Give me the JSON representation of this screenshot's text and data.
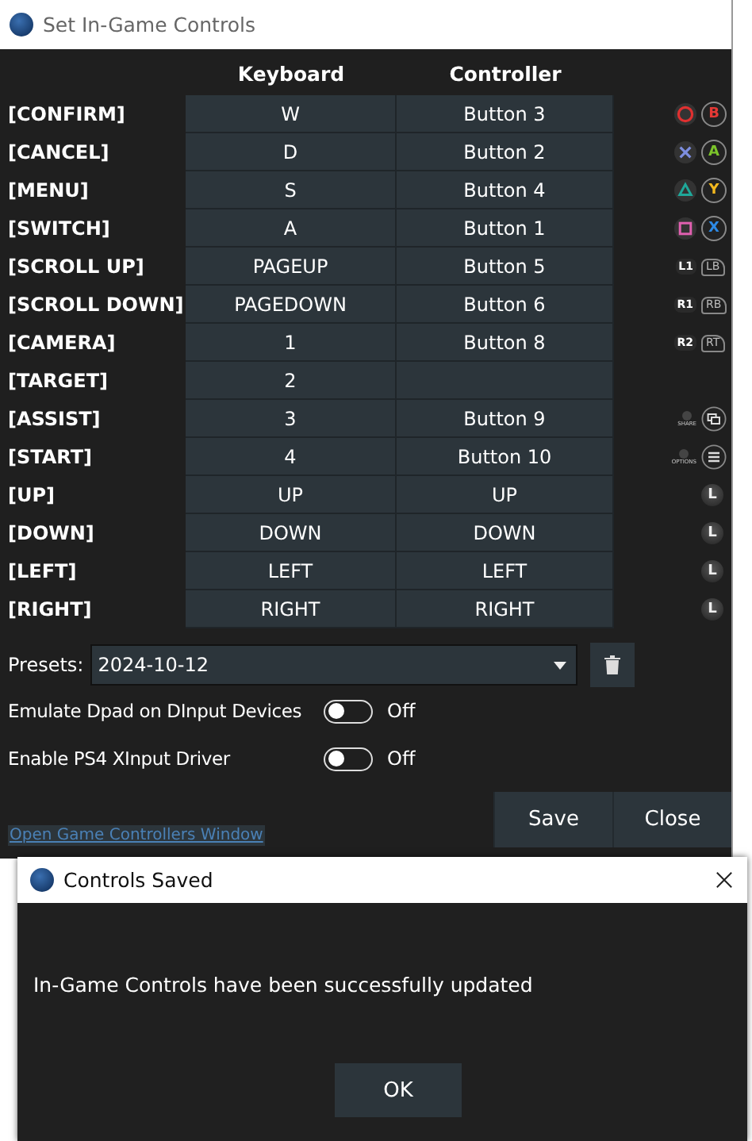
{
  "window": {
    "title": "Set In-Game Controls"
  },
  "columns": [
    "Keyboard",
    "Controller"
  ],
  "rows": [
    {
      "action": "[CONFIRM]",
      "keyboard": "W",
      "controller": "Button 3",
      "ps_icon": {
        "kind": "circle"
      },
      "xbox_icon": {
        "kind": "face",
        "label": "B",
        "color": "#e53935"
      }
    },
    {
      "action": "[CANCEL]",
      "keyboard": "D",
      "controller": "Button 2",
      "ps_icon": {
        "kind": "cross"
      },
      "xbox_icon": {
        "kind": "face",
        "label": "A",
        "color": "#7cc52b"
      }
    },
    {
      "action": "[MENU]",
      "keyboard": "S",
      "controller": "Button 4",
      "ps_icon": {
        "kind": "triangle"
      },
      "xbox_icon": {
        "kind": "face",
        "label": "Y",
        "color": "#f2b81e"
      }
    },
    {
      "action": "[SWITCH]",
      "keyboard": "A",
      "controller": "Button 1",
      "ps_icon": {
        "kind": "square"
      },
      "xbox_icon": {
        "kind": "face",
        "label": "X",
        "color": "#2d8ae6"
      }
    },
    {
      "action": "[SCROLL UP]",
      "keyboard": "PAGEUP",
      "controller": "Button 5",
      "ps_icon": {
        "kind": "key",
        "label": "L1"
      },
      "xbox_icon": {
        "kind": "bumper",
        "label": "LB"
      }
    },
    {
      "action": "[SCROLL DOWN]",
      "keyboard": "PAGEDOWN",
      "controller": "Button 6",
      "ps_icon": {
        "kind": "key",
        "label": "R1"
      },
      "xbox_icon": {
        "kind": "bumper",
        "label": "RB"
      }
    },
    {
      "action": "[CAMERA]",
      "keyboard": "1",
      "controller": "Button 8",
      "ps_icon": {
        "kind": "key",
        "label": "R2"
      },
      "xbox_icon": {
        "kind": "bumper",
        "label": "RT"
      }
    },
    {
      "action": "[TARGET]",
      "keyboard": "2"
    },
    {
      "action": "[ASSIST]",
      "keyboard": "3",
      "controller": "Button 9",
      "ps_icon": {
        "kind": "small",
        "label": "SHARE"
      },
      "xbox_icon": {
        "kind": "view"
      }
    },
    {
      "action": "[START]",
      "keyboard": "4",
      "controller": "Button 10",
      "ps_icon": {
        "kind": "small",
        "label": "OPTIONS"
      },
      "xbox_icon": {
        "kind": "menu"
      }
    },
    {
      "action": "[UP]",
      "keyboard": "UP",
      "controller": "UP",
      "xbox_icon": {
        "kind": "stick",
        "label": "L"
      }
    },
    {
      "action": "[DOWN]",
      "keyboard": "DOWN",
      "controller": "DOWN",
      "xbox_icon": {
        "kind": "stick",
        "label": "L"
      }
    },
    {
      "action": "[LEFT]",
      "keyboard": "LEFT",
      "controller": "LEFT",
      "xbox_icon": {
        "kind": "stick",
        "label": "L"
      }
    },
    {
      "action": "[RIGHT]",
      "keyboard": "RIGHT",
      "controller": "RIGHT",
      "xbox_icon": {
        "kind": "stick",
        "label": "L"
      }
    }
  ],
  "presets": {
    "label": "Presets:",
    "value": "2024-10-12"
  },
  "toggles": [
    {
      "label": "Emulate Dpad on DInput Devices",
      "on": false,
      "state_text": "Off"
    },
    {
      "label": "Enable PS4 XInput Driver",
      "on": false,
      "state_text": "Off"
    }
  ],
  "link": "Open Game Controllers Window",
  "buttons": [
    "Save",
    "Close"
  ],
  "dialog": {
    "title": "Controls Saved",
    "message": "In-Game Controls have been successfully updated",
    "button": "OK"
  }
}
